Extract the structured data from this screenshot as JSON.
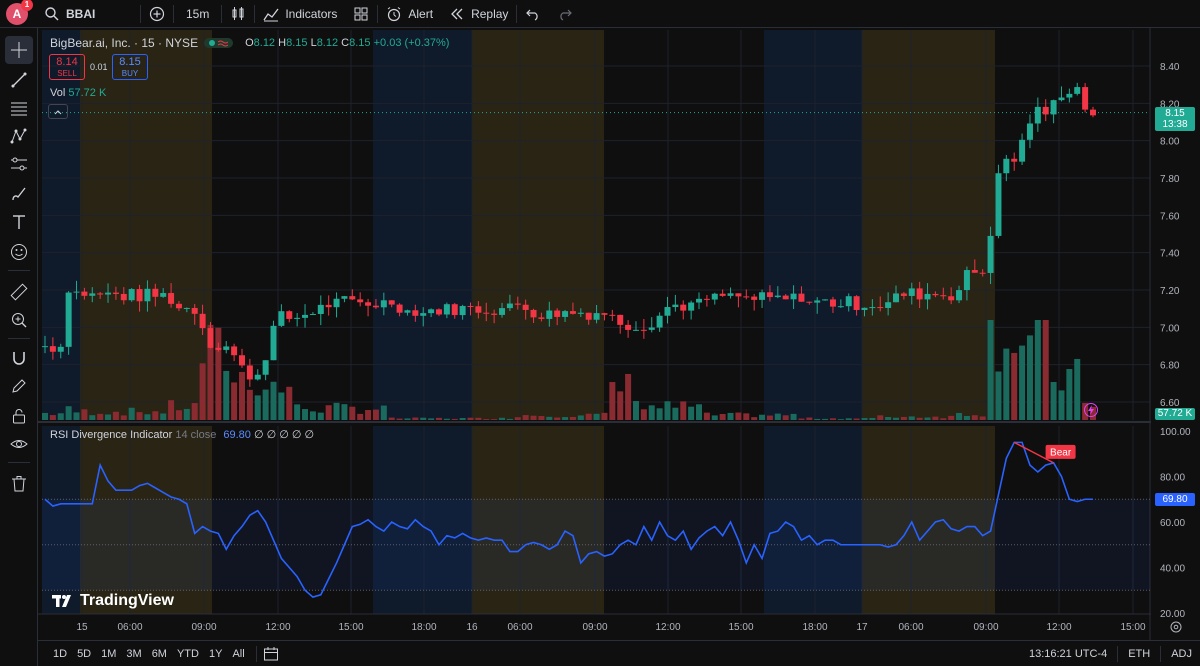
{
  "toolbar": {
    "avatar_letter": "A",
    "avatar_badge": "1",
    "symbol": "BBAI",
    "interval": "15m",
    "indicators_label": "Indicators",
    "alert_label": "Alert",
    "replay_label": "Replay"
  },
  "legend": {
    "title": "BigBear.ai, Inc. · 15 · NYSE",
    "open_key": "O",
    "open": "8.12",
    "high_key": "H",
    "high": "8.15",
    "low_key": "L",
    "low": "8.12",
    "close_key": "C",
    "close": "8.15",
    "change": "+0.03 (+0.37%)",
    "sell_price": "8.14",
    "sell_label": "SELL",
    "buy_price": "8.15",
    "buy_label": "BUY",
    "spread": "0.01",
    "vol_label": "Vol",
    "vol_value": "57.72 K"
  },
  "rsi_legend": {
    "name": "RSI Divergence Indicator",
    "params": "14 close",
    "value": "69.80",
    "extra": "∅ ∅ ∅ ∅ ∅",
    "bear_label": "Bear"
  },
  "price_axis": {
    "ticks": [
      "8.40",
      "8.20",
      "8.00",
      "7.80",
      "7.60",
      "7.40",
      "7.20",
      "7.00",
      "6.80",
      "6.60"
    ],
    "last_price": "8.15",
    "countdown": "13:38",
    "vol_tag": "57.72 K"
  },
  "rsi_axis": {
    "ticks": [
      "100.00",
      "80.00",
      "60.00",
      "40.00",
      "20.00"
    ],
    "value_tag": "69.80"
  },
  "time_axis": {
    "ticks": [
      "15",
      "06:00",
      "09:00",
      "12:00",
      "15:00",
      "18:00",
      "16",
      "06:00",
      "09:00",
      "12:00",
      "15:00",
      "18:00",
      "17",
      "06:00",
      "09:00",
      "12:00",
      "15:00"
    ]
  },
  "branding": {
    "text": "TradingView"
  },
  "bottom": {
    "ranges": [
      "1D",
      "5D",
      "1M",
      "3M",
      "6M",
      "YTD",
      "1Y",
      "All"
    ],
    "clock": "13:16:21 UTC-4",
    "session": "ETH",
    "adj": "ADJ"
  },
  "colors": {
    "up": "#22ab94",
    "down": "#f23645",
    "rsi": "#2962ff",
    "bear": "#f23645",
    "premarket_band": "#2a2414",
    "postmarket_band": "#0f1a2a"
  },
  "chart_data": {
    "type": "candlestick",
    "symbol": "BBAI",
    "interval": "15",
    "price_range": [
      6.5,
      8.5
    ],
    "rsi_range": [
      20,
      100
    ],
    "rsi_levels": [
      70,
      50,
      30
    ],
    "segments": [
      {
        "from": 0,
        "to": 3,
        "close": 6.9,
        "vol": 0.04
      },
      {
        "from": 3,
        "to": 4,
        "close": 7.22,
        "vol": 0.06
      },
      {
        "from": 4,
        "to": 16,
        "close": 7.17,
        "vol": 0.05
      },
      {
        "from": 16,
        "to": 20,
        "close": 7.1,
        "vol": 0.08
      },
      {
        "from": 20,
        "to": 24,
        "close": 6.9,
        "vol": 0.4
      },
      {
        "from": 24,
        "to": 28,
        "close": 6.75,
        "vol": 0.25
      },
      {
        "from": 28,
        "to": 32,
        "close": 7.05,
        "vol": 0.2
      },
      {
        "from": 32,
        "to": 44,
        "close": 7.13,
        "vol": 0.07
      },
      {
        "from": 44,
        "to": 60,
        "close": 7.1,
        "vol": 0.01
      },
      {
        "from": 60,
        "to": 72,
        "close": 7.08,
        "vol": 0.03
      },
      {
        "from": 72,
        "to": 76,
        "close": 7.02,
        "vol": 0.2
      },
      {
        "from": 76,
        "to": 84,
        "close": 7.12,
        "vol": 0.08
      },
      {
        "from": 84,
        "to": 96,
        "close": 7.15,
        "vol": 0.03
      },
      {
        "from": 96,
        "to": 106,
        "close": 7.13,
        "vol": 0.01
      },
      {
        "from": 106,
        "to": 116,
        "close": 7.18,
        "vol": 0.02
      },
      {
        "from": 116,
        "to": 120,
        "close": 7.3,
        "vol": 0.04
      },
      {
        "from": 120,
        "to": 124,
        "close": 7.9,
        "vol": 0.55
      },
      {
        "from": 124,
        "to": 128,
        "close": 8.15,
        "vol": 0.45
      },
      {
        "from": 128,
        "to": 132,
        "close": 8.28,
        "vol": 0.25
      },
      {
        "from": 132,
        "to": 134,
        "close": 8.15,
        "vol": 0.12
      }
    ],
    "rsi": [
      70,
      67,
      68,
      68,
      68,
      68,
      68,
      85,
      78,
      74,
      74,
      74,
      76,
      77,
      75,
      73,
      71,
      70,
      68,
      55,
      58,
      56,
      55,
      48,
      54,
      58,
      63,
      65,
      60,
      52,
      44,
      40,
      36,
      30,
      27,
      28,
      35,
      42,
      50,
      58,
      59,
      61,
      58,
      56,
      60,
      58,
      57,
      61,
      58,
      56,
      50,
      54,
      53,
      55,
      53,
      52,
      53,
      52,
      52,
      47,
      47,
      50,
      51,
      50,
      48,
      50,
      56,
      54,
      42,
      46,
      47,
      45,
      46,
      50,
      52,
      50,
      58,
      52,
      60,
      54,
      52,
      56,
      48,
      53,
      56,
      58,
      54,
      60,
      52,
      42,
      50,
      44,
      55,
      56,
      60,
      58,
      52,
      54,
      50,
      52,
      52,
      50,
      50,
      50,
      50,
      50,
      50,
      49,
      50,
      54,
      60,
      52,
      56,
      60,
      61,
      57,
      56,
      58,
      58,
      54,
      56,
      72,
      88,
      95,
      95,
      85,
      82,
      85,
      86,
      80,
      70,
      69,
      70,
      70
    ]
  }
}
